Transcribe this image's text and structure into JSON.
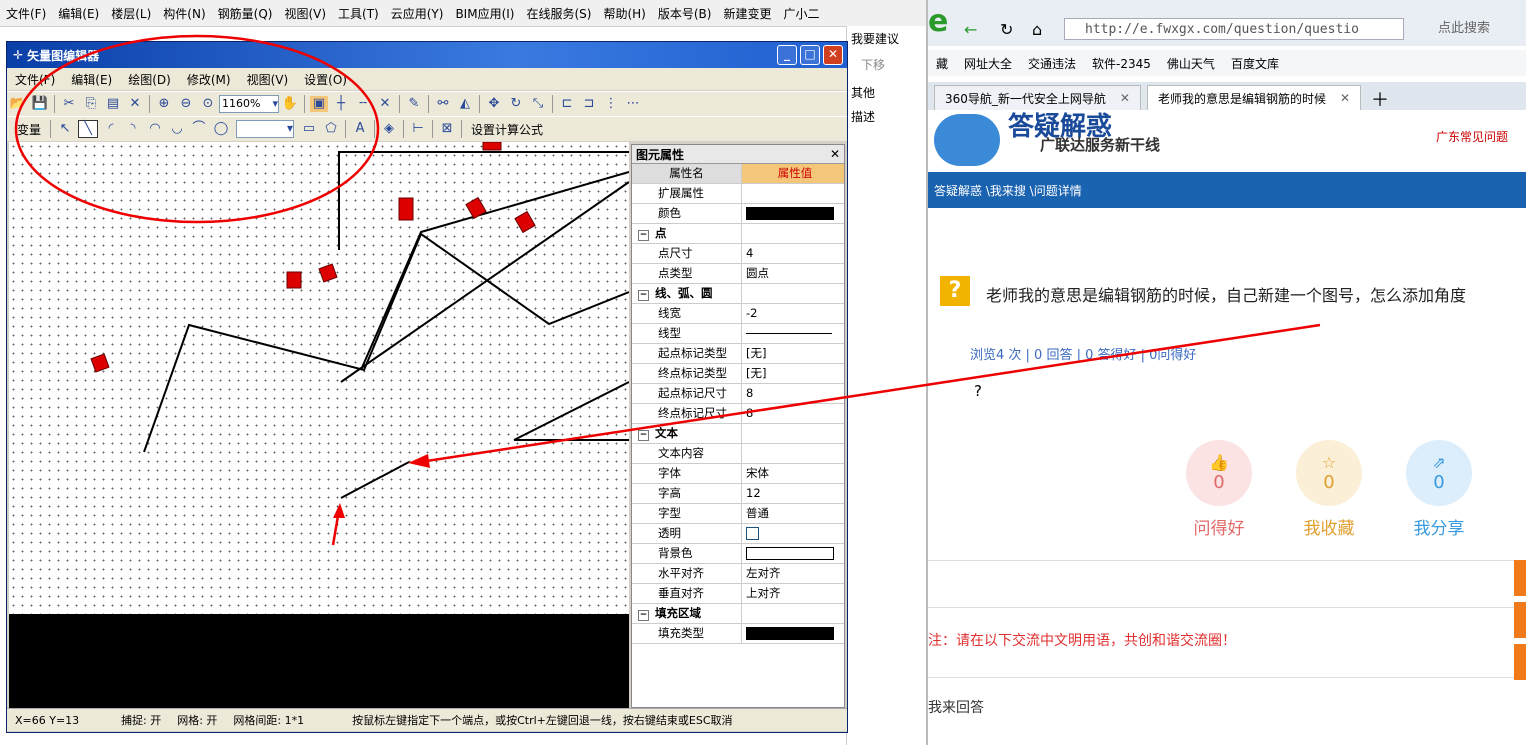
{
  "bg_app": {
    "menu": [
      "文件(F)",
      "编辑(E)",
      "楼层(L)",
      "构件(N)",
      "钢筋量(Q)",
      "视图(V)",
      "工具(T)",
      "云应用(Y)",
      "BIM应用(I)",
      "在线服务(S)",
      "帮助(H)",
      "版本号(B)",
      "新建变更",
      "广小二"
    ],
    "side_labels": [
      "我要建议",
      "下移",
      "其他",
      "描述"
    ]
  },
  "editor": {
    "title": "矢量图编辑器",
    "menu": [
      "文件(F)",
      "编辑(E)",
      "绘图(D)",
      "修改(M)",
      "视图(V)",
      "设置(O)"
    ],
    "zoom": "1160%",
    "var_label": "变量",
    "formula_label": "设置计算公式",
    "props": {
      "title": "图元属性",
      "header": {
        "name": "属性名",
        "value": "属性值"
      },
      "rows": [
        {
          "type": "row",
          "k": "扩展属性",
          "v": ""
        },
        {
          "type": "row",
          "k": "颜色",
          "v": "",
          "swatch": "#000000"
        },
        {
          "type": "grp",
          "k": "点",
          "v": ""
        },
        {
          "type": "row",
          "k": "点尺寸",
          "v": "4"
        },
        {
          "type": "row",
          "k": "点类型",
          "v": "圆点"
        },
        {
          "type": "grp",
          "k": "线、弧、圆",
          "v": ""
        },
        {
          "type": "row",
          "k": "线宽",
          "v": "-2"
        },
        {
          "type": "row",
          "k": "线型",
          "v": "",
          "line": true
        },
        {
          "type": "row",
          "k": "起点标记类型",
          "v": "[无]"
        },
        {
          "type": "row",
          "k": "终点标记类型",
          "v": "[无]"
        },
        {
          "type": "row",
          "k": "起点标记尺寸",
          "v": "8"
        },
        {
          "type": "row",
          "k": "终点标记尺寸",
          "v": "8"
        },
        {
          "type": "grp",
          "k": "文本",
          "v": ""
        },
        {
          "type": "row",
          "k": "文本内容",
          "v": ""
        },
        {
          "type": "row",
          "k": "字体",
          "v": "宋体"
        },
        {
          "type": "row",
          "k": "字高",
          "v": "12"
        },
        {
          "type": "row",
          "k": "字型",
          "v": "普通"
        },
        {
          "type": "row",
          "k": "透明",
          "v": "",
          "check": true
        },
        {
          "type": "row",
          "k": "背景色",
          "v": "",
          "swatch": "#ffffff"
        },
        {
          "type": "row",
          "k": "水平对齐",
          "v": "左对齐"
        },
        {
          "type": "row",
          "k": "垂直对齐",
          "v": "上对齐"
        },
        {
          "type": "grp",
          "k": "填充区域",
          "v": ""
        },
        {
          "type": "row",
          "k": "填充类型",
          "v": "",
          "swatch": "#000000"
        }
      ]
    },
    "status": {
      "coords": "X=66 Y=13",
      "snap": "捕捉: 开",
      "grid": "网格: 开",
      "spacing": "网格间距: 1*1",
      "hint": "按鼠标左键指定下一个端点，或按Ctrl+左键回退一线，按右键结束或ESC取消"
    }
  },
  "browser": {
    "url": "http://e.fwxgx.com/question/questio",
    "search_placeholder": "点此搜索",
    "bookmarks": [
      "藏",
      "网址大全",
      "交通违法",
      "软件-2345",
      "佛山天气",
      "百度文库"
    ],
    "tabs": [
      "360导航_新一代安全上网导航",
      "老师我的意思是编辑钢筋的时候"
    ],
    "site_title": "答疑解惑",
    "site_sub": "广联达服务新干线",
    "site_link": "广东常见问题",
    "breadcrumb": "答疑解惑 \\我来搜 \\问题详情",
    "question": "老师我的意思是编辑钢筋的时候，自己新建一个图号，怎么添加角度",
    "stats": "浏览4 次 | 0 回答 | 0 答得好 | 0问得好",
    "body": "?",
    "actions": [
      {
        "label": "问得好",
        "count": "0",
        "color": "#e06a6a",
        "bg": "#fbe3e3"
      },
      {
        "label": "我收藏",
        "count": "0",
        "color": "#e0a030",
        "bg": "#fcefd7"
      },
      {
        "label": "我分享",
        "count": "0",
        "color": "#3a9ae0",
        "bg": "#dcedfb"
      }
    ],
    "notice": "注：请在以下交流中文明用语，共创和谐交流圈！",
    "answer_label": "我来回答"
  }
}
